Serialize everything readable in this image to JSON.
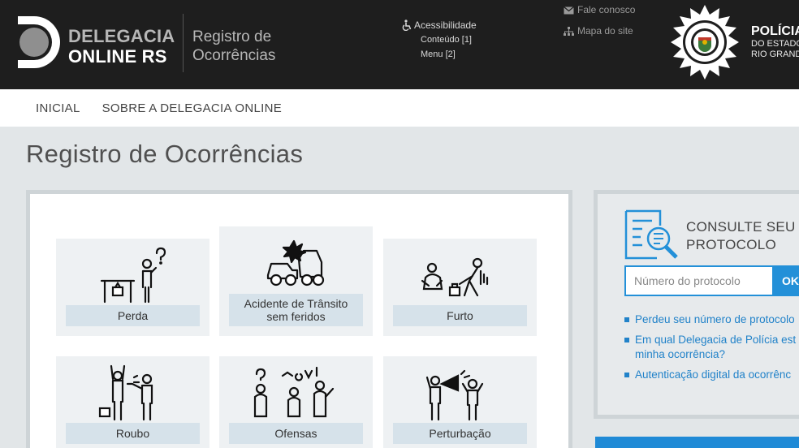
{
  "header": {
    "logo_line1": "DELEGACIA",
    "logo_line2": "ONLINE RS",
    "logo_sub_line1": "Registro de",
    "logo_sub_line2": "Ocorrências",
    "accessibility": {
      "title": "Acessibilidade",
      "links": [
        "Conteúdo [1]",
        "Menu [2]"
      ]
    },
    "contact": {
      "fale_conosco": "Fale conosco",
      "mapa_site": "Mapa do site"
    },
    "policia": {
      "title": "POLÍCIA",
      "line2": "DO ESTADO",
      "line3": "RIO GRANDE"
    }
  },
  "nav": {
    "items": [
      "INICIAL",
      "SOBRE A DELEGACIA ONLINE"
    ]
  },
  "page": {
    "title": "Registro de Ocorrências"
  },
  "tiles": [
    {
      "label": "Perda",
      "icon": "lost-item-icon"
    },
    {
      "label": "Acidente de Trânsito sem feridos",
      "icon": "traffic-accident-icon"
    },
    {
      "label": "Furto",
      "icon": "theft-icon"
    },
    {
      "label": "Roubo",
      "icon": "robbery-icon"
    },
    {
      "label": "Ofensas",
      "icon": "offense-icon"
    },
    {
      "label": "Perturbação",
      "icon": "disturbance-icon"
    }
  ],
  "protocol": {
    "title_line1": "CONSULTE SEU",
    "title_line2": "PROTOCOLO",
    "placeholder": "Número do protocolo",
    "ok_label": "OK",
    "links": [
      "Perdeu seu número de protocolo",
      "Em qual Delegacia de Polícia est minha ocorrência?",
      "Autenticação digital da ocorrênc"
    ]
  },
  "colors": {
    "header_bg": "#1e1e1e",
    "accent_blue": "#2390d8",
    "page_bg": "#e2e6e8"
  }
}
